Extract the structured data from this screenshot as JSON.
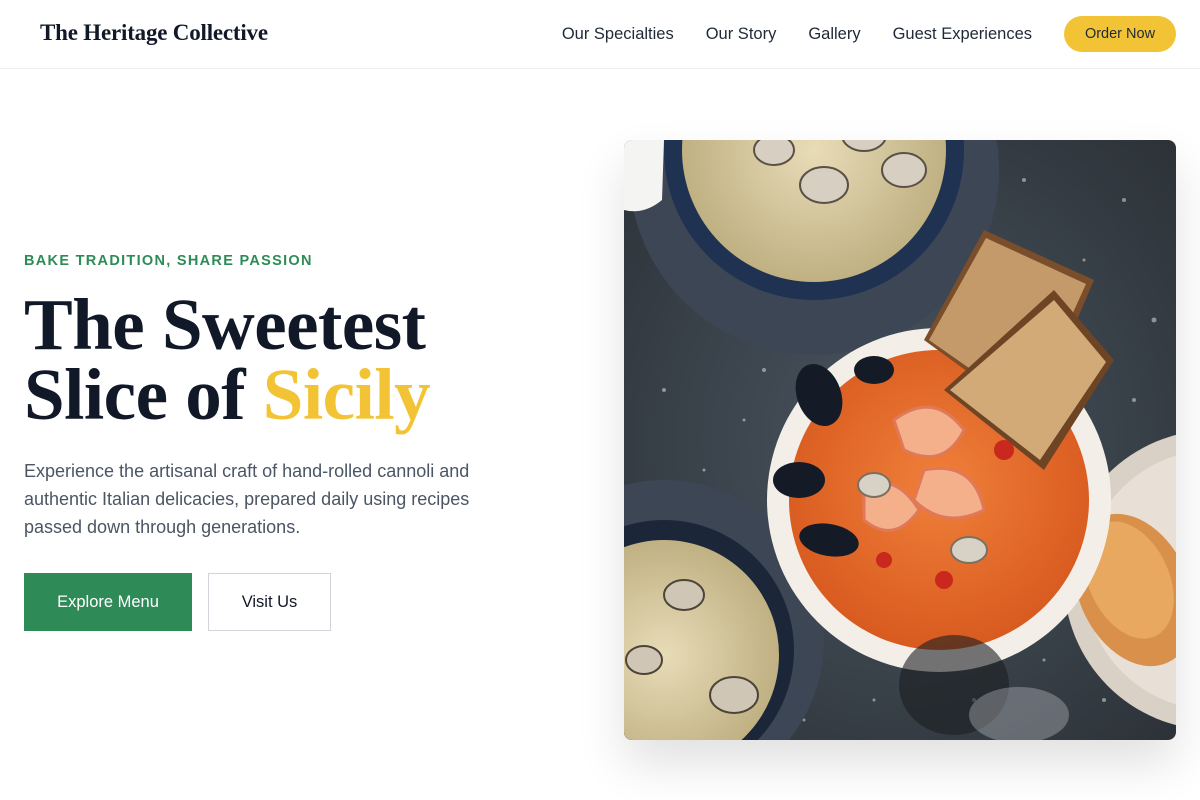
{
  "header": {
    "brand": "The Heritage Collective",
    "nav": [
      {
        "label": "Our Specialties"
      },
      {
        "label": "Our Story"
      },
      {
        "label": "Gallery"
      },
      {
        "label": "Guest Experiences"
      }
    ],
    "cta_label": "Order Now"
  },
  "hero": {
    "eyebrow": "BAKE TRADITION, SHARE PASSION",
    "headline_line1": "The Sweetest",
    "headline_line2_prefix": "Slice of ",
    "headline_accent": "Sicily",
    "description": "Experience the artisanal craft of hand-rolled cannoli and authentic Italian delicacies, prepared daily using recipes passed down through generations.",
    "primary_button": "Explore Menu",
    "secondary_button": "Visit Us",
    "image_icon": "seafood-dish-photo"
  },
  "colors": {
    "accent_yellow": "#f2c435",
    "brand_green": "#2e8b57",
    "text_dark": "#111827"
  }
}
